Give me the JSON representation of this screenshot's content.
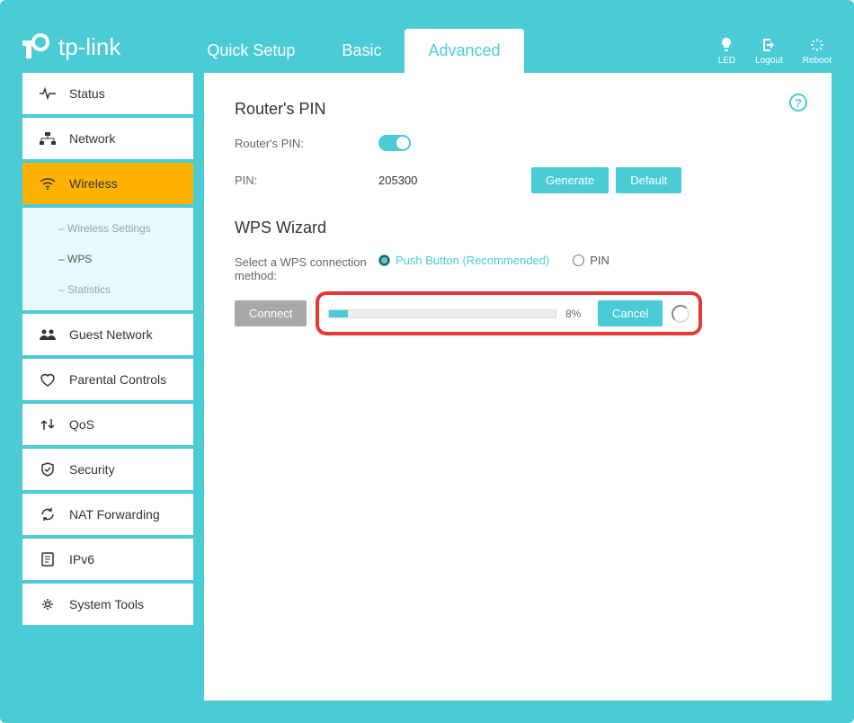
{
  "brand": "tp-link",
  "tabs": [
    {
      "label": "Quick Setup",
      "active": false
    },
    {
      "label": "Basic",
      "active": false
    },
    {
      "label": "Advanced",
      "active": true
    }
  ],
  "header_actions": {
    "led": "LED",
    "logout": "Logout",
    "reboot": "Reboot"
  },
  "sidebar": {
    "items": [
      {
        "label": "Status",
        "icon": "status"
      },
      {
        "label": "Network",
        "icon": "network"
      },
      {
        "label": "Wireless",
        "icon": "wireless",
        "active": true,
        "sub": [
          {
            "label": "Wireless Settings"
          },
          {
            "label": "WPS",
            "active": true
          },
          {
            "label": "Statistics"
          }
        ]
      },
      {
        "label": "Guest Network",
        "icon": "guest"
      },
      {
        "label": "Parental Controls",
        "icon": "parental"
      },
      {
        "label": "QoS",
        "icon": "qos"
      },
      {
        "label": "Security",
        "icon": "security"
      },
      {
        "label": "NAT Forwarding",
        "icon": "nat"
      },
      {
        "label": "IPv6",
        "icon": "ipv6"
      },
      {
        "label": "System Tools",
        "icon": "tools"
      }
    ]
  },
  "routers_pin": {
    "section_title": "Router's PIN",
    "toggle_label": "Router's PIN:",
    "toggle_on": true,
    "pin_label": "PIN:",
    "pin_value": "205300",
    "generate": "Generate",
    "default": "Default"
  },
  "wps_wizard": {
    "section_title": "WPS Wizard",
    "method_label": "Select a WPS connection method:",
    "push_button": "Push Button (Recommended)",
    "pin_option": "PIN",
    "connect": "Connect",
    "cancel": "Cancel",
    "progress_percent": 8,
    "progress_text": "8%"
  }
}
